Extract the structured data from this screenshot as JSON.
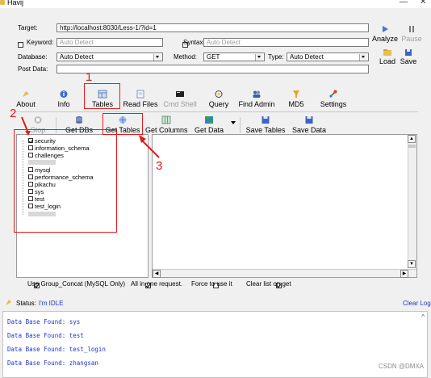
{
  "window": {
    "title": "Havij",
    "minimize_glyph": "—",
    "close_glyph": "✕"
  },
  "form": {
    "target_label": "Target:",
    "target_value": "http://localhost:8030/Less-1/?id=1",
    "keyword_label": "Keyword:",
    "keyword_value": "Auto Detect",
    "syntax_label": "Syntax",
    "syntax_value": "Auto Detect",
    "database_label": "Database:",
    "database_value": "Auto Detect",
    "method_label": "Method:",
    "method_value": "GET",
    "type_label": "Type:",
    "type_value": "Auto Detect",
    "postdata_label": "Post Data:",
    "postdata_value": ""
  },
  "actions": {
    "analyze": "Analyze",
    "pause": "Pause",
    "load": "Load",
    "save": "Save"
  },
  "main_tabs": [
    {
      "label": "About",
      "icon": "about-icon"
    },
    {
      "label": "Info",
      "icon": "info-icon"
    },
    {
      "label": "Tables",
      "icon": "tables-icon"
    },
    {
      "label": "Read Files",
      "icon": "read-files-icon"
    },
    {
      "label": "Cmd Shell",
      "icon": "cmd-shell-icon"
    },
    {
      "label": "Query",
      "icon": "query-icon"
    },
    {
      "label": "Find Admin",
      "icon": "find-admin-icon"
    },
    {
      "label": "MD5",
      "icon": "md5-icon"
    },
    {
      "label": "Settings",
      "icon": "settings-icon"
    }
  ],
  "sub_toolbar": [
    {
      "label": "Stop",
      "icon": "stop-icon"
    },
    {
      "label": "Get DBs",
      "icon": "get-dbs-icon"
    },
    {
      "label": "Get Tables",
      "icon": "get-tables-icon"
    },
    {
      "label": "Get Columns",
      "icon": "get-columns-icon"
    },
    {
      "label": "Get Data",
      "icon": "get-data-icon"
    },
    {
      "label": "Save Tables",
      "icon": "save-tables-icon"
    },
    {
      "label": "Save Data",
      "icon": "save-data-icon"
    }
  ],
  "db_tree": [
    {
      "label": "security",
      "checked": true
    },
    {
      "label": "information_schema",
      "checked": false
    },
    {
      "label": "challenges",
      "checked": false
    },
    {
      "label": "",
      "checked": false,
      "blurred": true
    },
    {
      "label": "mysql",
      "checked": false
    },
    {
      "label": "performance_schema",
      "checked": false
    },
    {
      "label": "pikachu",
      "checked": false
    },
    {
      "label": "sys",
      "checked": false
    },
    {
      "label": "test",
      "checked": false
    },
    {
      "label": "test_login",
      "checked": false
    },
    {
      "label": "",
      "checked": false,
      "blurred": true
    }
  ],
  "options": {
    "group_concat": "Use Group_Concat (MySQL Only)",
    "all_in_one": "All in one request.",
    "force": "Force to use it",
    "clear_list": "Clear list on get"
  },
  "status": {
    "label": "Status:",
    "value": "I'm IDLE",
    "clear_log": "Clear Log"
  },
  "log": [
    "Data Base Found: sys",
    "Data Base Found: test",
    "Data Base Found: test_login",
    "Data Base Found: zhangsan"
  ],
  "annotations": [
    "1",
    "2",
    "3"
  ],
  "watermark": "CSDN @DMXA",
  "colors": {
    "annotation_red": "#e41b1b",
    "log_blue": "#1f35c7",
    "status_blue": "#1f35c7"
  }
}
